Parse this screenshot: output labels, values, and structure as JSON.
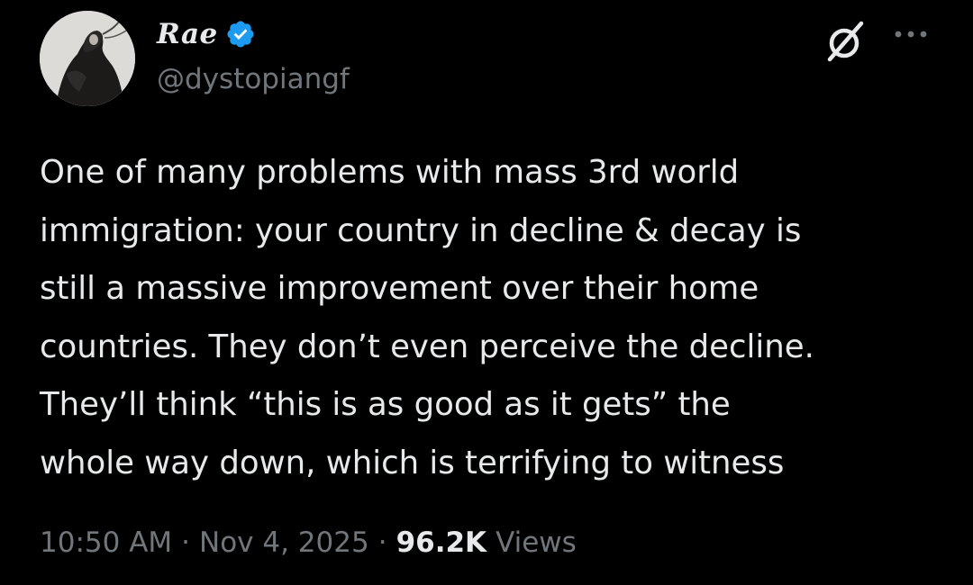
{
  "author": {
    "display_name": "Rae",
    "handle": "@dystopiangf",
    "verified": true
  },
  "icons": {
    "avatar": "profile-photo",
    "verified": "verified-badge-icon",
    "grok": "grok-icon",
    "more": "more-options-icon"
  },
  "colors": {
    "background": "#000000",
    "text": "#e7e9ea",
    "secondary_text": "#71767b",
    "verified_blue": "#1d9bf0"
  },
  "tweet": {
    "lines": [
      "One of many problems with mass 3rd world",
      "immigration: your country in decline & decay is",
      "still a massive improvement over their home",
      "countries. They don’t even perceive the decline.",
      "They’ll think “this is as good as it gets” the",
      "whole way down, which is terrifying to witness"
    ]
  },
  "meta": {
    "time": "10:50 AM",
    "date": "Nov 4, 2025",
    "separator": "·",
    "views_count": "96.2K",
    "views_label": "Views"
  }
}
